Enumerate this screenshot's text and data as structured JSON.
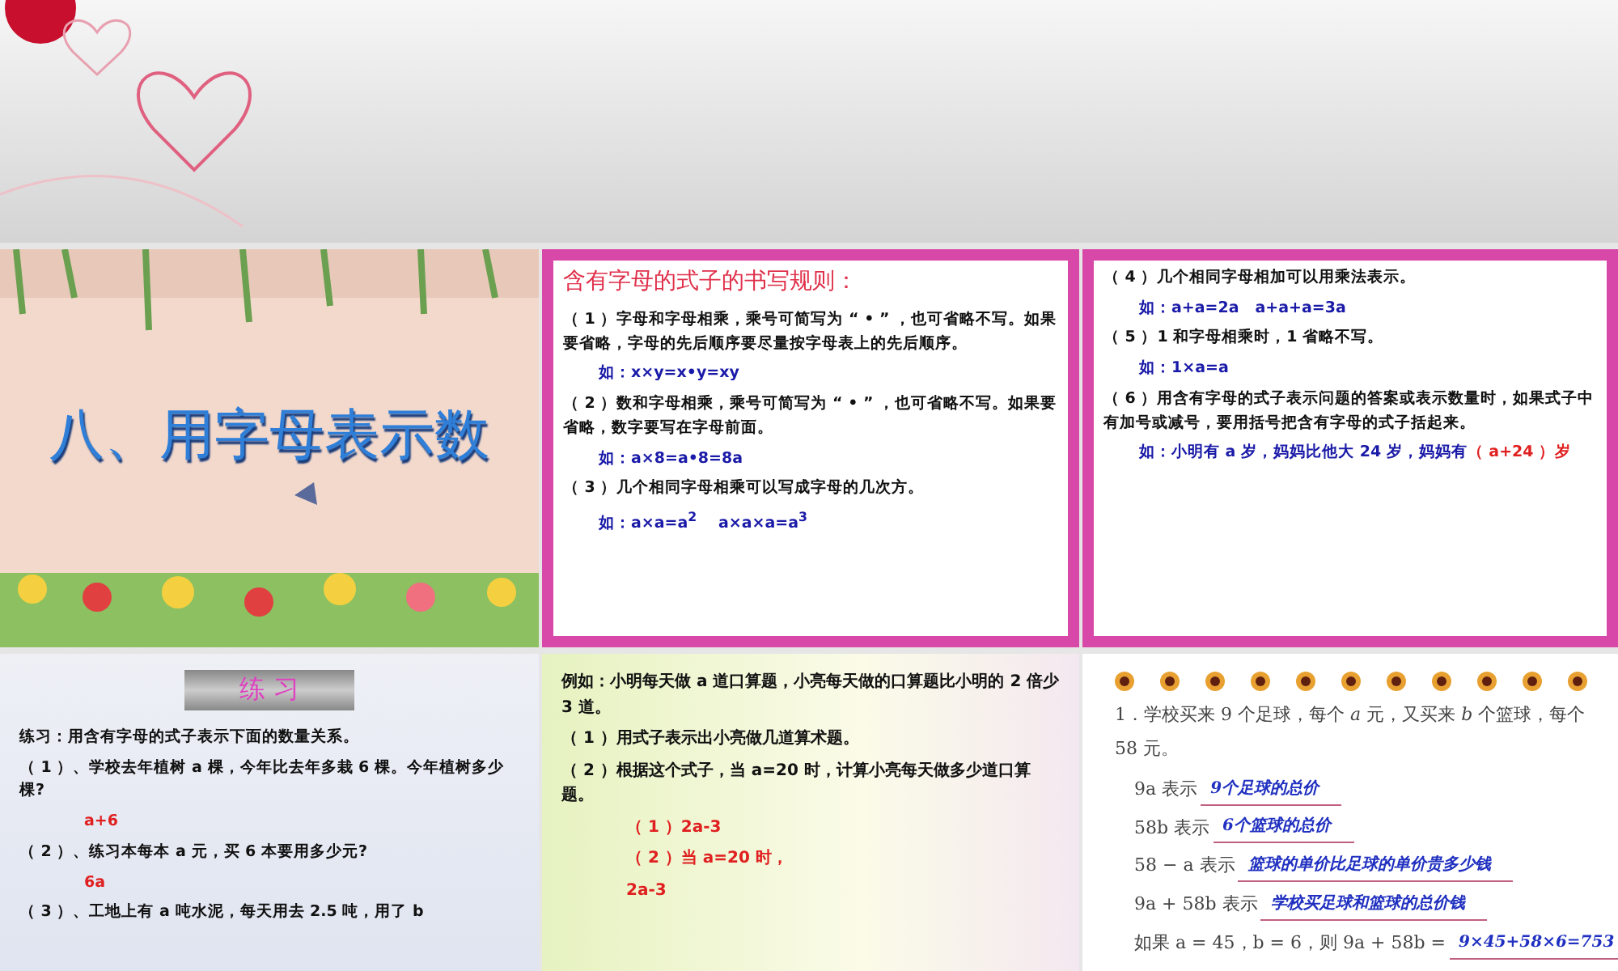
{
  "slides": [
    {
      "kind": "title",
      "title": "八、用字母表示数"
    },
    {
      "kind": "rules",
      "heading": "含有字母的式子的书写规则：",
      "lines": [
        {
          "kind": "text",
          "text": "（ 1 ）字母和字母相乘，乘号可简写为 “ • ” ，也可省略不写。如果要省略，字母的先后顺序要尽量按字母表上的先后顺序。"
        },
        {
          "kind": "example",
          "text": "如：x×y=x•y=xy"
        },
        {
          "kind": "text",
          "text": "（ 2 ）数和字母相乘，乘号可简写为 “ • ” ，也可省略不写。如果要省略，数字要写在字母前面。"
        },
        {
          "kind": "example",
          "text": "如：a×8=a•8=8a"
        },
        {
          "kind": "text",
          "text": "（ 3 ）几个相同字母相乘可以写成字母的几次方。"
        },
        {
          "kind": "example",
          "text": "如：a×a=a$^{2}$　 a×a×a=a$^{3}$"
        }
      ]
    },
    {
      "kind": "rules",
      "lines": [
        {
          "kind": "text",
          "text": "（ 4 ）几个相同字母相加可以用乘法表示。"
        },
        {
          "kind": "example",
          "text": "如：a+a=2a　a+a+a=3a"
        },
        {
          "kind": "text",
          "text": "（ 5 ）1 和字母相乘时，1 省略不写。"
        },
        {
          "kind": "example",
          "text": "如：1×a=a"
        },
        {
          "kind": "text",
          "text": "（ 6 ）用含有字母的式子表示问题的答案或表示数量时，如果式子中有加号或减号，要用括号把含有字母的式子括起来。"
        },
        {
          "kind": "example",
          "text": "如：小明有 a 岁，妈妈比他大 24 岁，妈妈有",
          "answer": "（ a+24 ）岁"
        }
      ]
    },
    {
      "kind": "exercise",
      "banner": "练 习",
      "lines": [
        {
          "kind": "text",
          "text": "练习：用含有字母的式子表示下面的数量关系。"
        },
        {
          "kind": "text",
          "text": "（ 1 ）、学校去年植树 a 棵，今年比去年多栽 6 棵。今年植树多少棵?"
        },
        {
          "kind": "answer",
          "text": "a+6"
        },
        {
          "kind": "text",
          "text": "（ 2 ）、练习本每本 a 元，买 6 本要用多少元?"
        },
        {
          "kind": "answer",
          "text": "6a"
        },
        {
          "kind": "text",
          "text": "（ 3 ）、工地上有 a 吨水泥，每天用去 2.5 吨，用了 b"
        }
      ]
    },
    {
      "kind": "example",
      "lines": [
        {
          "kind": "text",
          "text": "例如：小明每天做 a 道口算题，小亮每天做的口算题比小明的 2 倍少 3 道。"
        },
        {
          "kind": "text",
          "text": "（ 1 ）用式子表示出小亮做几道算术题。"
        },
        {
          "kind": "text",
          "text": "（ 2 ）根据这个式子，当 a=20 时，计算小亮每天做多少道口算题。"
        },
        {
          "kind": "answer",
          "text": "（ 1 ）2a-3"
        },
        {
          "kind": "answer",
          "text": "（ 2 ）当 a=20 时，"
        },
        {
          "kind": "answer",
          "text": "2a-3"
        }
      ]
    },
    {
      "kind": "worksheet",
      "question": "1．学校买来 9 个足球，每个 *a* 元，又买来 *b* 个篮球，每个 58 元。",
      "lines": [
        {
          "label": "9a 表示",
          "answer": "9个足球的总价"
        },
        {
          "label": "58b 表示",
          "answer": "6个篮球的总价"
        },
        {
          "label": "58 − a 表示",
          "answer": "篮球的单价比足球的单价贵多少钱"
        },
        {
          "label": "9a + 58b 表示",
          "answer": "学校买足球和篮球的总价钱"
        },
        {
          "label": "如果 a = 45，b = 6，则 9a + 58b =",
          "answer": "9×45+58×6=753"
        }
      ]
    }
  ]
}
